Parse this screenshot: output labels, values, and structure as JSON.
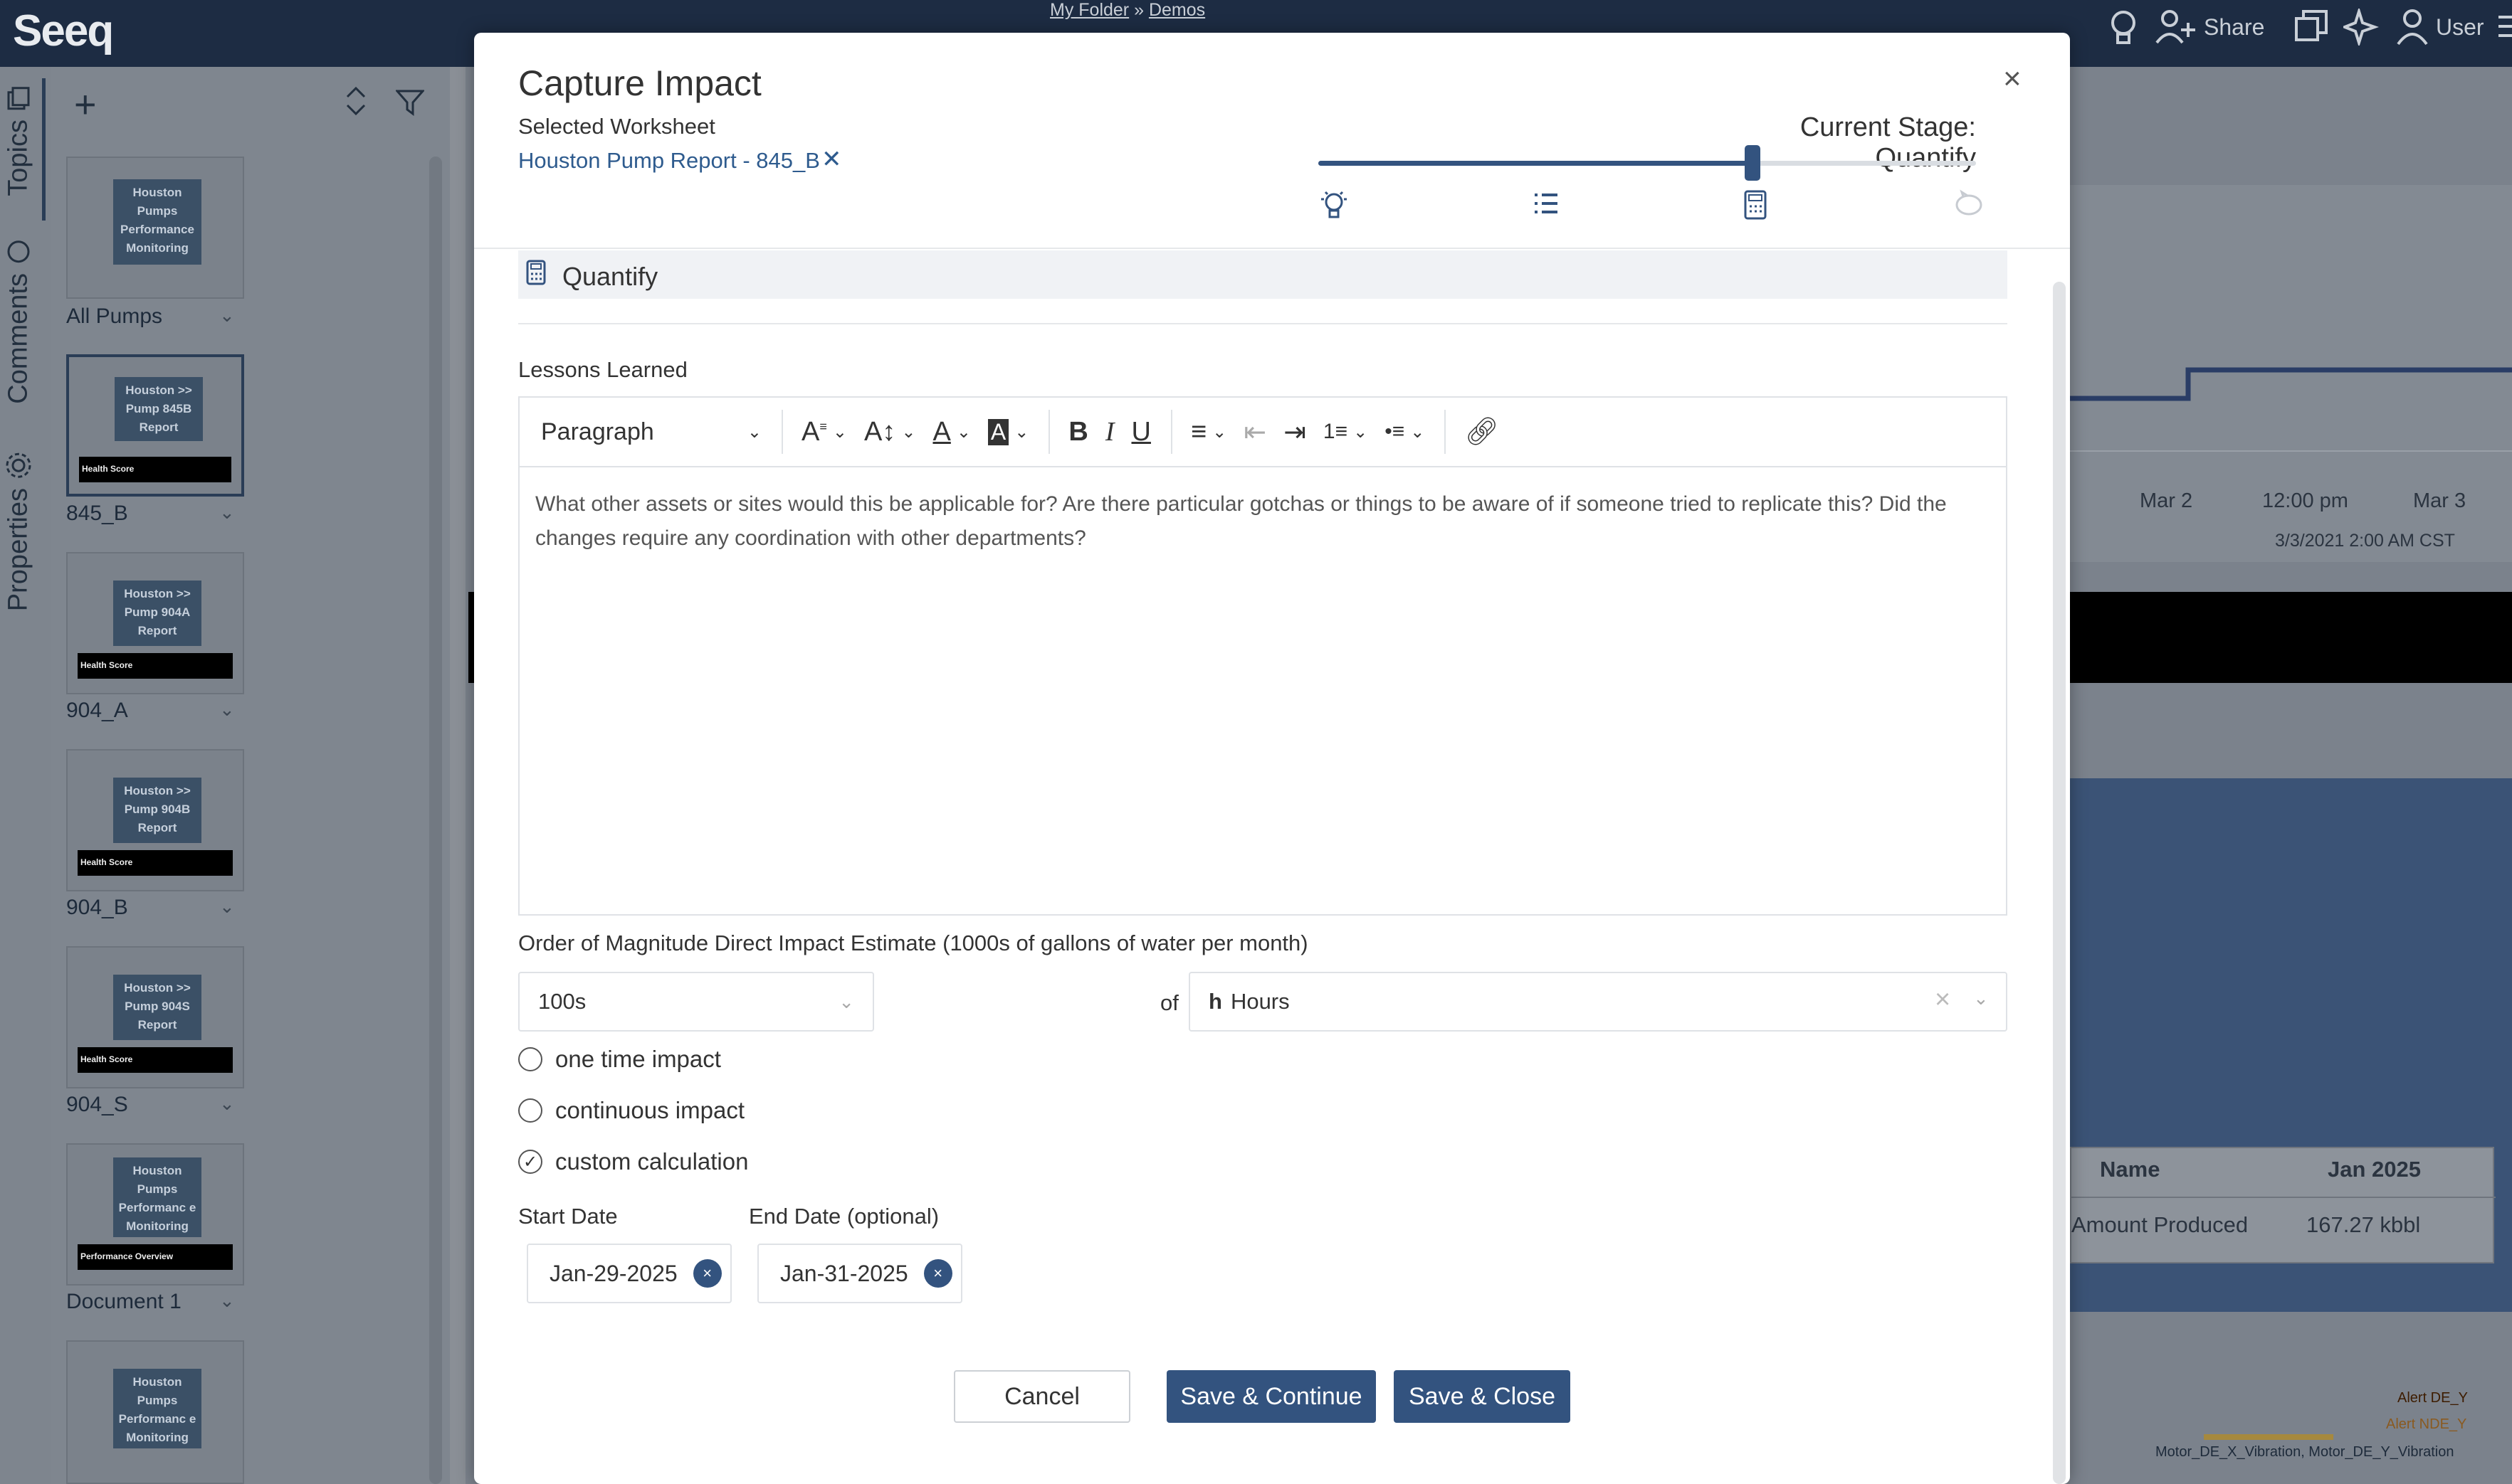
{
  "app": {
    "logo": "Seeq",
    "breadcrumb": {
      "folder": "My Folder",
      "separator": " » ",
      "current": "Demos"
    },
    "topbar": {
      "share": "Share",
      "user": "User"
    },
    "rail": {
      "topics": "Topics",
      "comments": "Comments",
      "properties": "Properties"
    }
  },
  "worksheets": [
    {
      "label": "All Pumps",
      "title": "Houston Pumps Performance Monitoring",
      "banner": ""
    },
    {
      "label": "845_B",
      "title": "Houston >> Pump 845B Report",
      "banner": "Health Score"
    },
    {
      "label": "904_A",
      "title": "Houston >> Pump 904A Report",
      "banner": "Health Score"
    },
    {
      "label": "904_B",
      "title": "Houston >> Pump 904B Report",
      "banner": "Health Score"
    },
    {
      "label": "904_S",
      "title": "Houston >> Pump 904S Report",
      "banner": "Health Score"
    },
    {
      "label": "Document 1",
      "title": "Houston Pumps Performanc e Monitoring",
      "banner": "Performance Overview"
    },
    {
      "label": "",
      "title": "Houston Pumps Performanc e Monitoring",
      "banner": ""
    }
  ],
  "modal": {
    "title": "Capture Impact",
    "selected_worksheet_label": "Selected Worksheet",
    "selected_worksheet": "Houston Pump Report - 845_B",
    "current_stage": "Current Stage: Quantify",
    "stage_progress_percent": 66,
    "section_title": "Quantify",
    "lessons_label": "Lessons Learned",
    "editor": {
      "paragraph": "Paragraph",
      "placeholder": "What other assets or sites would this be applicable for? Are there particular gotchas or things to be aware of if someone tried to replicate this? Did the changes require any coordination with other departments?"
    },
    "magnitude_label": "Order of Magnitude Direct Impact Estimate (1000s of gallons of water per month)",
    "magnitude_value": "100s",
    "of_label": "of",
    "unit_prefix": "h",
    "unit_value": "Hours",
    "radios": {
      "one_time": "one time impact",
      "continuous": "continuous impact",
      "custom": "custom calculation",
      "selected": "custom"
    },
    "start_label": "Start Date",
    "end_label": "End Date (optional)",
    "start_date": "Jan-29-2025",
    "end_date": "Jan-31-2025",
    "buttons": {
      "cancel": "Cancel",
      "save_continue": "Save & Continue",
      "save_close": "Save & Close"
    }
  },
  "background": {
    "axis_labels": [
      "Mar 2",
      "12:00 pm",
      "Mar 3"
    ],
    "timestamp": "3/3/2021 2:00 AM  CST",
    "table": {
      "headers": [
        "Name",
        "Jan 2025"
      ],
      "row": [
        "Amount Produced",
        "167.27 kbbl"
      ]
    },
    "legend": [
      "Alert DE_Y",
      "Alert NDE_Y",
      "Motor_DE_X_Vibration, Motor_DE_Y_Vibration"
    ]
  }
}
